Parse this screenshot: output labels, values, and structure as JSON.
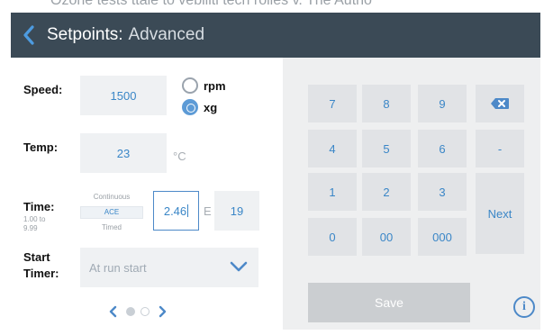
{
  "top_fragment": "Ozone tests ttale to vebiliti tech rolles v. The Autho",
  "header": {
    "title_main": "Setpoints:",
    "title_sub": "Advanced"
  },
  "speed": {
    "label": "Speed:",
    "value": "1500",
    "units": [
      {
        "label": "rpm",
        "selected": false
      },
      {
        "label": "xg",
        "selected": true
      }
    ]
  },
  "temp": {
    "label": "Temp:",
    "value": "23",
    "unit": "°C"
  },
  "time": {
    "label": "Time:",
    "range_line1": "1.00 to",
    "range_line2": "9.99",
    "picker_options": [
      "Continuous",
      "ACE",
      "Timed"
    ],
    "mantissa": "2.46",
    "e_label": "E",
    "exponent": "19"
  },
  "start_timer": {
    "label_line1": "Start",
    "label_line2": "Timer:",
    "value": "At run start"
  },
  "pager": {
    "pages": 2,
    "current": 1
  },
  "keypad": {
    "keys": [
      "7",
      "8",
      "9",
      "4",
      "5",
      "6",
      "-",
      "1",
      "2",
      "3",
      "0",
      "00",
      "000"
    ],
    "next_label": "Next",
    "backspace_icon": "backspace-icon"
  },
  "actions": {
    "save_label": "Save",
    "info_label": "i"
  },
  "colors": {
    "header": "#3b4a56",
    "accent": "#3a86c7",
    "field_bg": "#eff1f3",
    "keypad_bg": "#eeeff0",
    "key_bg": "#e1e3e6",
    "save_disabled": "#cbced1"
  }
}
